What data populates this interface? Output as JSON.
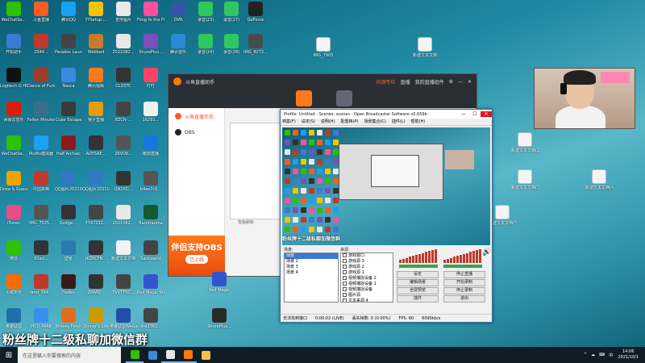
{
  "desktop": {
    "left_icons": [
      {
        "label": "WeChatSe...",
        "color": "#2dc100"
      },
      {
        "label": "斗鱼直播",
        "color": "#ff5a1f"
      },
      {
        "label": "腾讯QQ",
        "color": "#1aa0f0"
      },
      {
        "label": "YYSetup-...",
        "color": "#f5c400"
      },
      {
        "label": "宣传图片",
        "color": "#e8e8e8"
      },
      {
        "label": "Fling to the Finish",
        "color": "#ff4fa0"
      },
      {
        "label": "OVR",
        "color": "#3355aa"
      },
      {
        "label": "录音(23)",
        "color": "#2ec760"
      },
      {
        "label": "录音(27)",
        "color": "#2ec760"
      },
      {
        "label": "GeForce",
        "color": "#222"
      },
      {
        "label": "开机助手",
        "color": "#3a7bd5"
      },
      {
        "label": "2344...",
        "color": "#c0392b"
      },
      {
        "label": "Paradox Launcher v2",
        "color": "#444"
      },
      {
        "label": "Webbed",
        "color": "#c97a2b"
      },
      {
        "label": "2021082...",
        "color": "#e8e8e8"
      },
      {
        "label": "ShurePlus...",
        "color": "#7a4fc0"
      },
      {
        "label": "腾讯音乐",
        "color": "#2b8ad8"
      },
      {
        "label": "录音(24)",
        "color": "#2ec760"
      },
      {
        "label": "录音(28)",
        "color": "#2ec760"
      },
      {
        "label": "IMG_8272...",
        "color": "#4a4a4a"
      },
      {
        "label": "Logitech G HUB",
        "color": "#111"
      },
      {
        "label": "Dance of Furies",
        "color": "#9b3c2c"
      },
      {
        "label": "Nasca",
        "color": "#3b8ae0"
      },
      {
        "label": "腾讯视频",
        "color": "#ff7a1a"
      },
      {
        "label": "CLDSTC",
        "color": "#333"
      },
      {
        "label": "叮叮",
        "color": "#ff4466"
      },
      {
        "label": "网易云音乐",
        "color": "#d81e06"
      },
      {
        "label": "Fallen Minutes",
        "color": "#3a6e8f"
      },
      {
        "label": "Cube Escape",
        "color": "#3a3a3a"
      },
      {
        "label": "猴子直播",
        "color": "#e89b10"
      },
      {
        "label": "8ZCN-...",
        "color": "#444"
      },
      {
        "label": "16291...",
        "color": "#f0f0f0"
      },
      {
        "label": "WeChatSe...",
        "color": "#2dc100"
      },
      {
        "label": "MuMu模拟器",
        "color": "#1ea0f0"
      },
      {
        "label": "Half Archaic",
        "color": "#8b1a1a"
      },
      {
        "label": "AOYSAE...",
        "color": "#333"
      },
      {
        "label": "2RVOX...",
        "color": "#555"
      },
      {
        "label": "酷狗直播",
        "color": "#1777e0"
      },
      {
        "label": "Draw & Guess",
        "color": "#f3a300"
      },
      {
        "label": "中国象棋",
        "color": "#c0392b"
      },
      {
        "label": "QQ图片2021085...",
        "color": "#2e7bc4"
      },
      {
        "label": "QQ图片2021085...",
        "color": "#2e7bc4"
      },
      {
        "label": "QN2XD...",
        "color": "#333"
      },
      {
        "label": "b4ee7c5...",
        "color": "#555"
      },
      {
        "label": "iTunes",
        "color": "#ea4c89"
      },
      {
        "label": "IMG_7525...",
        "color": "#555"
      },
      {
        "label": "Dodge-...",
        "color": "#333"
      },
      {
        "label": "7747232...",
        "color": "#444"
      },
      {
        "label": "2021082...",
        "color": "#e8e8e8"
      },
      {
        "label": "Barotrauma",
        "color": "#145a32"
      },
      {
        "label": "微信",
        "color": "#2dc100"
      },
      {
        "label": "91ad...",
        "color": "#333"
      },
      {
        "label": "壁纸",
        "color": "#2a7ab0"
      },
      {
        "label": "JKZRCFN...",
        "color": "#333"
      },
      {
        "label": "新建文本文档",
        "color": "#f2f2f2"
      },
      {
        "label": "Sackwarid",
        "color": "#444"
      },
      {
        "label": "火绒安全",
        "color": "#ff6a00"
      },
      {
        "label": "land_384...",
        "color": "#c0392b"
      },
      {
        "label": "Hades",
        "color": "#3a1a1a"
      },
      {
        "label": "ZRWRJ...",
        "color": "#333"
      },
      {
        "label": "TVVTT5C...",
        "color": "#444"
      },
      {
        "label": "Red Magic Studio",
        "color": "#3355cc"
      },
      {
        "label": "英雄联盟",
        "color": "#1f6fa8"
      },
      {
        "label": "PICO PARK",
        "color": "#3a8ef0"
      },
      {
        "label": "Kittens Fetch",
        "color": "#e26c1c"
      },
      {
        "label": "Dinner's Life",
        "color": "#cc9900"
      },
      {
        "label": "英雄联盟WeGame版",
        "color": "#1f4fa8"
      },
      {
        "label": "9rd3382...",
        "color": "#444"
      }
    ],
    "right_icons": [
      {
        "label": "IMG_7905"
      },
      {
        "label": "新建文本文档"
      },
      {
        "label": "新建文本文档(2)"
      },
      {
        "label": "新建文本文档(3)"
      },
      {
        "label": "新建文本文档(4)"
      },
      {
        "label": "新建文本文档(5)"
      }
    ],
    "red_magic_label": "Red Magic",
    "shure_label": "ShurePlus..."
  },
  "douyu": {
    "title": "斗鱼直播助手",
    "link_hot": "内测专栏",
    "links": [
      "直播",
      "我的直播组件"
    ],
    "side_items": [
      "斗鱼直播伴侣",
      "OBS"
    ],
    "promo_big": "伴侣支持OBS",
    "promo_btn": "已上线",
    "refresh": "智能刷新"
  },
  "obs": {
    "title": "Profile: Untitled - Scenes: scenes - Open Broadcaster Software v0.659b",
    "menu": [
      "档案(F)",
      "设定(S)",
      "说明(H)",
      "配置档(P)",
      "场景集合(C)",
      "插件(L)",
      "帮助(H)"
    ],
    "scenes_label": "场景:",
    "sources_label": "来源:",
    "scenes": [
      "场景",
      "场景 2",
      "场景 3",
      "场景 4"
    ],
    "sources": [
      "游戏窗口",
      "游戏源 3",
      "游戏源 2",
      "游戏源 1",
      "视频捕捉设备 2",
      "视频捕捉设备 1",
      "视频捕捉设备",
      "图片源",
      "文本来源 4"
    ],
    "preview_banner": "粉丝牌十二级私聊加微信群",
    "buttons": [
      "设定",
      "停止直播",
      "编辑场景",
      "开始录制",
      "全屏预览",
      "停止录制",
      "插件",
      "退出"
    ],
    "status": [
      "无法找到接口",
      "0:00:02 (LIVE)",
      "丢失帧数: 0 (0.00%)",
      "FPS: 60",
      "6095kb/s"
    ]
  },
  "overlay_text": "粉丝牌十二级私聊加微信群",
  "taskbar": {
    "start_glyph": "⊞",
    "search_placeholder": "在这里输入你要搜索的内容",
    "apps": [
      {
        "color": "#2dc100",
        "active": true
      },
      {
        "color": "#3b8ad8",
        "active": false
      },
      {
        "color": "#e6e6e6",
        "active": true
      },
      {
        "color": "#ff7a00",
        "active": true
      },
      {
        "color": "#f6c14a",
        "active": false
      }
    ],
    "tray": [
      "^",
      "☁",
      "⌨",
      "中"
    ],
    "time": "14:06",
    "date": "2021/10/1"
  }
}
